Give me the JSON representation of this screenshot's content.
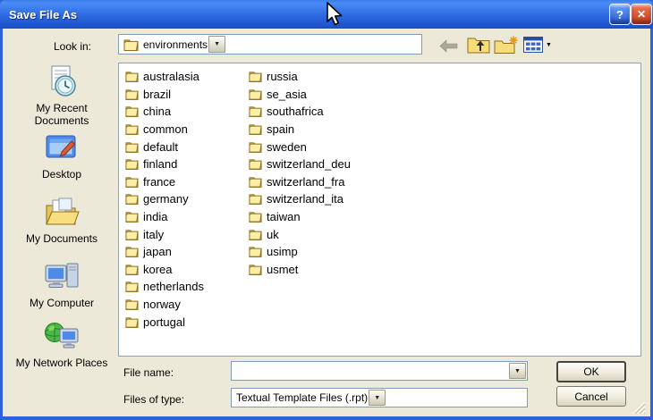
{
  "window": {
    "title": "Save File As"
  },
  "titlebar_buttons": {
    "help_glyph": "?",
    "close_glyph": "✕"
  },
  "toolbar": {
    "look_in_label": "Look in:",
    "look_in_value": "environments",
    "icons": [
      "back-arrow-icon",
      "up-one-level-icon",
      "new-folder-icon",
      "view-menu-icon"
    ]
  },
  "glyphs": {
    "dropdown_caret": "▼"
  },
  "sidebar": {
    "items": [
      {
        "label": "My Recent Documents",
        "icon": "recent-documents-icon"
      },
      {
        "label": "Desktop",
        "icon": "desktop-icon"
      },
      {
        "label": "My Documents",
        "icon": "my-documents-icon"
      },
      {
        "label": "My Computer",
        "icon": "my-computer-icon"
      },
      {
        "label": "My Network Places",
        "icon": "my-network-places-icon"
      }
    ]
  },
  "file_list": {
    "left_column": [
      "australasia",
      "brazil",
      "china",
      "common",
      "default",
      "finland",
      "france",
      "germany",
      "india",
      "italy",
      "japan",
      "korea",
      "netherlands",
      "norway",
      "portugal"
    ],
    "right_column": [
      "russia",
      "se_asia",
      "southafrica",
      "spain",
      "sweden",
      "switzerland_deu",
      "switzerland_fra",
      "switzerland_ita",
      "taiwan",
      "uk",
      "usimp",
      "usmet"
    ]
  },
  "fields": {
    "file_name_label": "File name:",
    "file_name_value": "",
    "files_of_type_label": "Files of type:",
    "files_of_type_value": "Textual Template Files (.rpt)"
  },
  "buttons": {
    "ok_label": "OK",
    "cancel_label": "Cancel"
  },
  "colors": {
    "titlebar_blue": "#2C68E0",
    "dialog_bg": "#ECE9D8",
    "close_red": "#C83A18",
    "folder_yellow": "#F6DD7A",
    "list_bg": "#FFFFFF"
  }
}
